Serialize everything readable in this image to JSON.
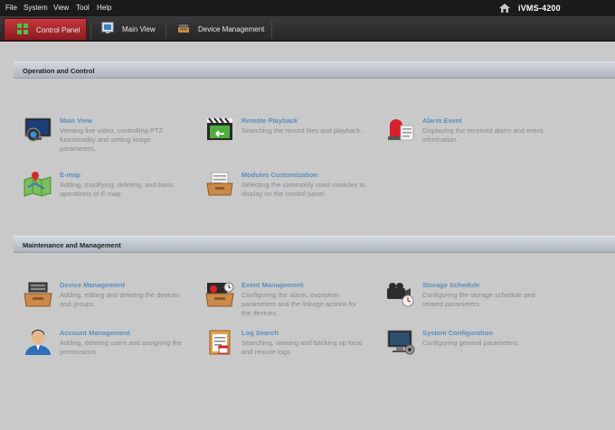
{
  "menubar": {
    "items": [
      "File",
      "System",
      "View",
      "Tool",
      "Help"
    ],
    "app_title": "iVMS-4200"
  },
  "tabs": [
    {
      "label": "Control Panel",
      "icon": "grid-icon",
      "active": true
    },
    {
      "label": "Main View",
      "icon": "monitor-icon",
      "active": false
    },
    {
      "label": "Device Management",
      "icon": "device-icon",
      "active": false
    }
  ],
  "sections": [
    {
      "title": "Operation and Control",
      "modules": [
        {
          "title": "Main View",
          "desc": "Viewing live video, controlling PTZ functionality and setting image parameters.",
          "icon": "main-view-icon"
        },
        {
          "title": "Remote Playback",
          "desc": "Searching the record files and playback.",
          "icon": "remote-playback-icon"
        },
        {
          "title": "Alarm Event",
          "desc": "Displaying the received alarm and event information.",
          "icon": "alarm-event-icon"
        },
        {
          "title": "E-map",
          "desc": "Adding, modifying, deleting, and basic operations of E-map.",
          "icon": "e-map-icon"
        },
        {
          "title": "Modules Customization",
          "desc": "Selecting the commonly used modules to display on the control panel.",
          "icon": "modules-customization-icon"
        }
      ]
    },
    {
      "title": "Maintenance and Management",
      "modules": [
        {
          "title": "Device Management",
          "desc": "Adding, editing and deleting the devices and groups.",
          "icon": "device-management-icon"
        },
        {
          "title": "Event Management",
          "desc": "Configuring the alarm, exception parameters and the linkage actions for the devices.",
          "icon": "event-management-icon"
        },
        {
          "title": "Storage Schedule",
          "desc": "Configuring the storage schedule and related parameters.",
          "icon": "storage-schedule-icon"
        },
        {
          "title": "Account Management",
          "desc": "Adding, deleting users and assigning the permissions.",
          "icon": "account-management-icon"
        },
        {
          "title": "Log Search",
          "desc": "Searching, viewing and backing up local and remote logs.",
          "icon": "log-search-icon"
        },
        {
          "title": "System Configuration",
          "desc": "Configuring general parameters.",
          "icon": "system-configuration-icon"
        }
      ]
    }
  ],
  "colors": {
    "menubar_bg": "#1b1b1b",
    "active_tab": "#b02a2f",
    "content_bg": "#c9c9c9",
    "module_title": "#5b8ec0",
    "module_desc": "#8a8a8a"
  }
}
